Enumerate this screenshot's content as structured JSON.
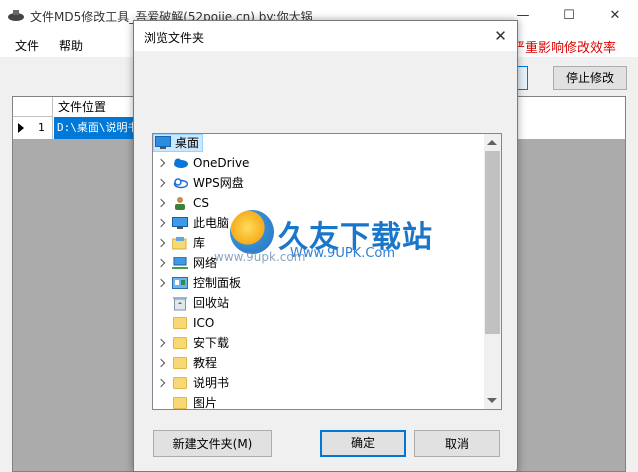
{
  "main_window": {
    "title": "文件MD5修改工具_吾爱破解(52pojie.cn)    by:你大锅",
    "minimize_glyph": "—",
    "maximize_glyph": "☐",
    "close_glyph": "✕",
    "menu": [
      "文件",
      "帮助"
    ],
    "notice_text": "严重影响修改效率",
    "stop_button_label": "停止修改",
    "grid": {
      "columns": [
        "文件位置"
      ],
      "rows": [
        {
          "index": "1",
          "path": "D:\\桌面\\说明书"
        }
      ]
    }
  },
  "dialog": {
    "title": "浏览文件夹",
    "close_glyph": "✕",
    "tree": [
      {
        "label": "桌面",
        "icon": "desktop-icon",
        "expandable": false,
        "selected": true
      },
      {
        "label": "OneDrive",
        "icon": "cloud-icon",
        "expandable": true
      },
      {
        "label": "WPS网盘",
        "icon": "cloud-outline-icon",
        "expandable": true
      },
      {
        "label": "CS",
        "icon": "user-icon",
        "expandable": true
      },
      {
        "label": "此电脑",
        "icon": "computer-icon",
        "expandable": true
      },
      {
        "label": "库",
        "icon": "library-icon",
        "expandable": true
      },
      {
        "label": "网络",
        "icon": "network-icon",
        "expandable": true
      },
      {
        "label": "控制面板",
        "icon": "control-panel-icon",
        "expandable": true
      },
      {
        "label": "回收站",
        "icon": "recycle-bin-icon",
        "expandable": false
      },
      {
        "label": "ICO",
        "icon": "folder-icon",
        "expandable": false
      },
      {
        "label": "安下载",
        "icon": "folder-icon",
        "expandable": true
      },
      {
        "label": "教程",
        "icon": "folder-icon",
        "expandable": true
      },
      {
        "label": "说明书",
        "icon": "folder-icon",
        "expandable": true
      },
      {
        "label": "图片",
        "icon": "folder-icon",
        "expandable": false
      }
    ],
    "new_folder_label": "新建文件夹(M)",
    "ok_label": "确定",
    "cancel_label": "取消"
  },
  "watermark": {
    "brand": "久友下载站",
    "domain": "Www.9UPK.Com",
    "url_faint": "www.9upk.com"
  },
  "colors": {
    "accent": "#0078d7",
    "notice": "#e00000",
    "grid_bg": "#ababab",
    "selection_bg": "#cce8ff"
  }
}
